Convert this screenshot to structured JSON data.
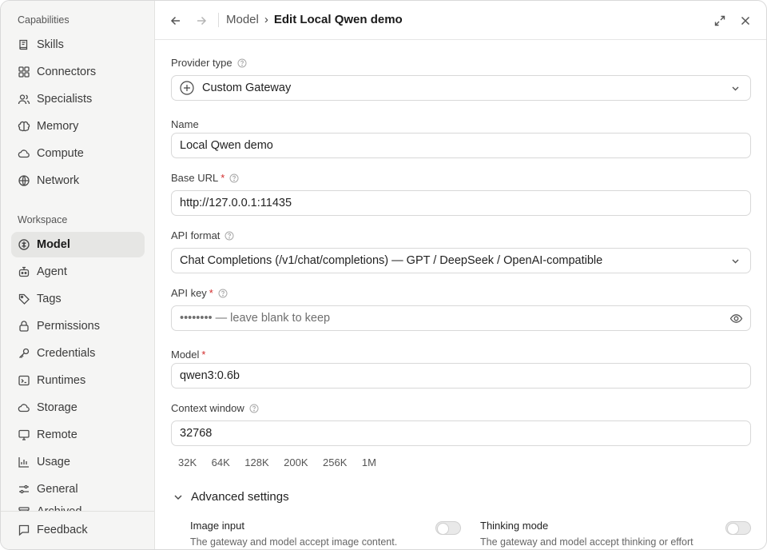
{
  "sidebar": {
    "capabilities_title": "Capabilities",
    "capabilities": [
      {
        "label": "Skills",
        "icon": "book-icon"
      },
      {
        "label": "Connectors",
        "icon": "grid-icon"
      },
      {
        "label": "Specialists",
        "icon": "users-icon"
      },
      {
        "label": "Memory",
        "icon": "brain-icon"
      },
      {
        "label": "Compute",
        "icon": "cloud-icon"
      },
      {
        "label": "Network",
        "icon": "globe-icon"
      }
    ],
    "workspace_title": "Workspace",
    "workspace": [
      {
        "label": "Model",
        "icon": "brain-icon",
        "active": true
      },
      {
        "label": "Agent",
        "icon": "bot-icon"
      },
      {
        "label": "Tags",
        "icon": "tag-icon"
      },
      {
        "label": "Permissions",
        "icon": "lock-icon"
      },
      {
        "label": "Credentials",
        "icon": "key-icon"
      },
      {
        "label": "Runtimes",
        "icon": "terminal-icon"
      },
      {
        "label": "Storage",
        "icon": "cloud-icon"
      },
      {
        "label": "Remote",
        "icon": "monitor-icon"
      },
      {
        "label": "Usage",
        "icon": "chart-icon"
      },
      {
        "label": "General",
        "icon": "sliders-icon"
      },
      {
        "label": "Archived",
        "icon": "archive-icon"
      }
    ],
    "feedback_label": "Feedback"
  },
  "header": {
    "parent": "Model",
    "separator": "›",
    "current": "Edit Local Qwen demo"
  },
  "form": {
    "provider_type_label": "Provider type",
    "provider_type_value": "Custom Gateway",
    "name_label": "Name",
    "name_value": "Local Qwen demo",
    "base_url_label": "Base URL",
    "base_url_value": "http://127.0.0.1:11435",
    "api_format_label": "API format",
    "api_format_value": "Chat Completions (/v1/chat/completions) — GPT / DeepSeek / OpenAI-compatible",
    "api_key_label": "API key",
    "api_key_placeholder": "•••••••• — leave blank to keep",
    "model_label": "Model",
    "model_value": "qwen3:0.6b",
    "context_window_label": "Context window",
    "context_window_value": "32768",
    "context_presets": [
      "32K",
      "64K",
      "128K",
      "200K",
      "256K",
      "1M"
    ],
    "required_mark": "*"
  },
  "advanced": {
    "title": "Advanced settings",
    "image_input_title": "Image input",
    "image_input_desc": "The gateway and model accept image content.",
    "image_input_enabled": false,
    "thinking_mode_title": "Thinking mode",
    "thinking_mode_desc": "The gateway and model accept thinking or effort",
    "thinking_mode_enabled": false
  },
  "colors": {
    "sidebar_bg": "#f5f5f4",
    "active_item_bg": "#e6e6e4",
    "required": "#d22c2c"
  }
}
